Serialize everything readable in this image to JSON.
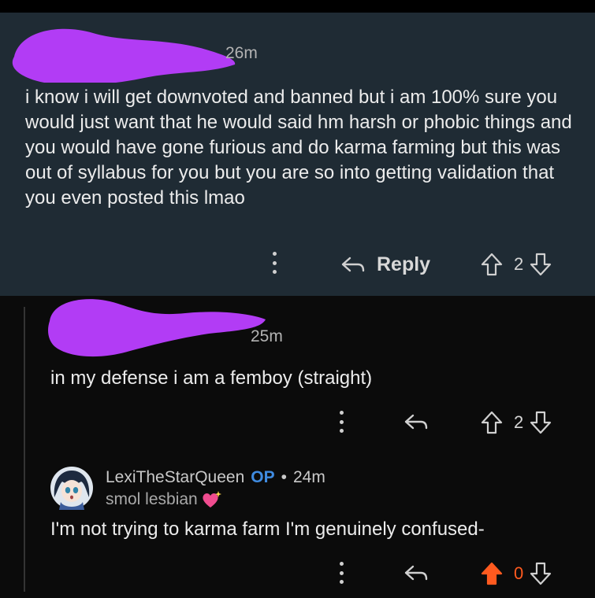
{
  "comments": [
    {
      "time": "26m",
      "body": "i know i will get downvoted and banned but i am 100% sure you would just want that he would said hm harsh or phobic things and you would have gone furious and do karma farming but this was out of syllabus for you but you are so into getting validation that you even posted this lmao",
      "reply_label": "Reply",
      "score": "2"
    },
    {
      "time": "25m",
      "body": "in my defense i am a femboy (straight)",
      "score": "2"
    },
    {
      "username": "LexiTheStarQueen",
      "op_badge": "OP",
      "separator": "•",
      "time": "24m",
      "flair": "smol lesbian",
      "body": "I'm not trying to karma farm I'm genuinely confused-",
      "score": "0"
    }
  ],
  "colors": {
    "highlight_bg": "#1f2b34",
    "op": "#3f8be0",
    "upvoted": "#ff5a1f",
    "redaction": "#b23cf5"
  },
  "icons": [
    "more-icon",
    "reply-arrow-icon",
    "upvote-icon",
    "downvote-icon",
    "avatar",
    "sparkling-heart-icon"
  ]
}
